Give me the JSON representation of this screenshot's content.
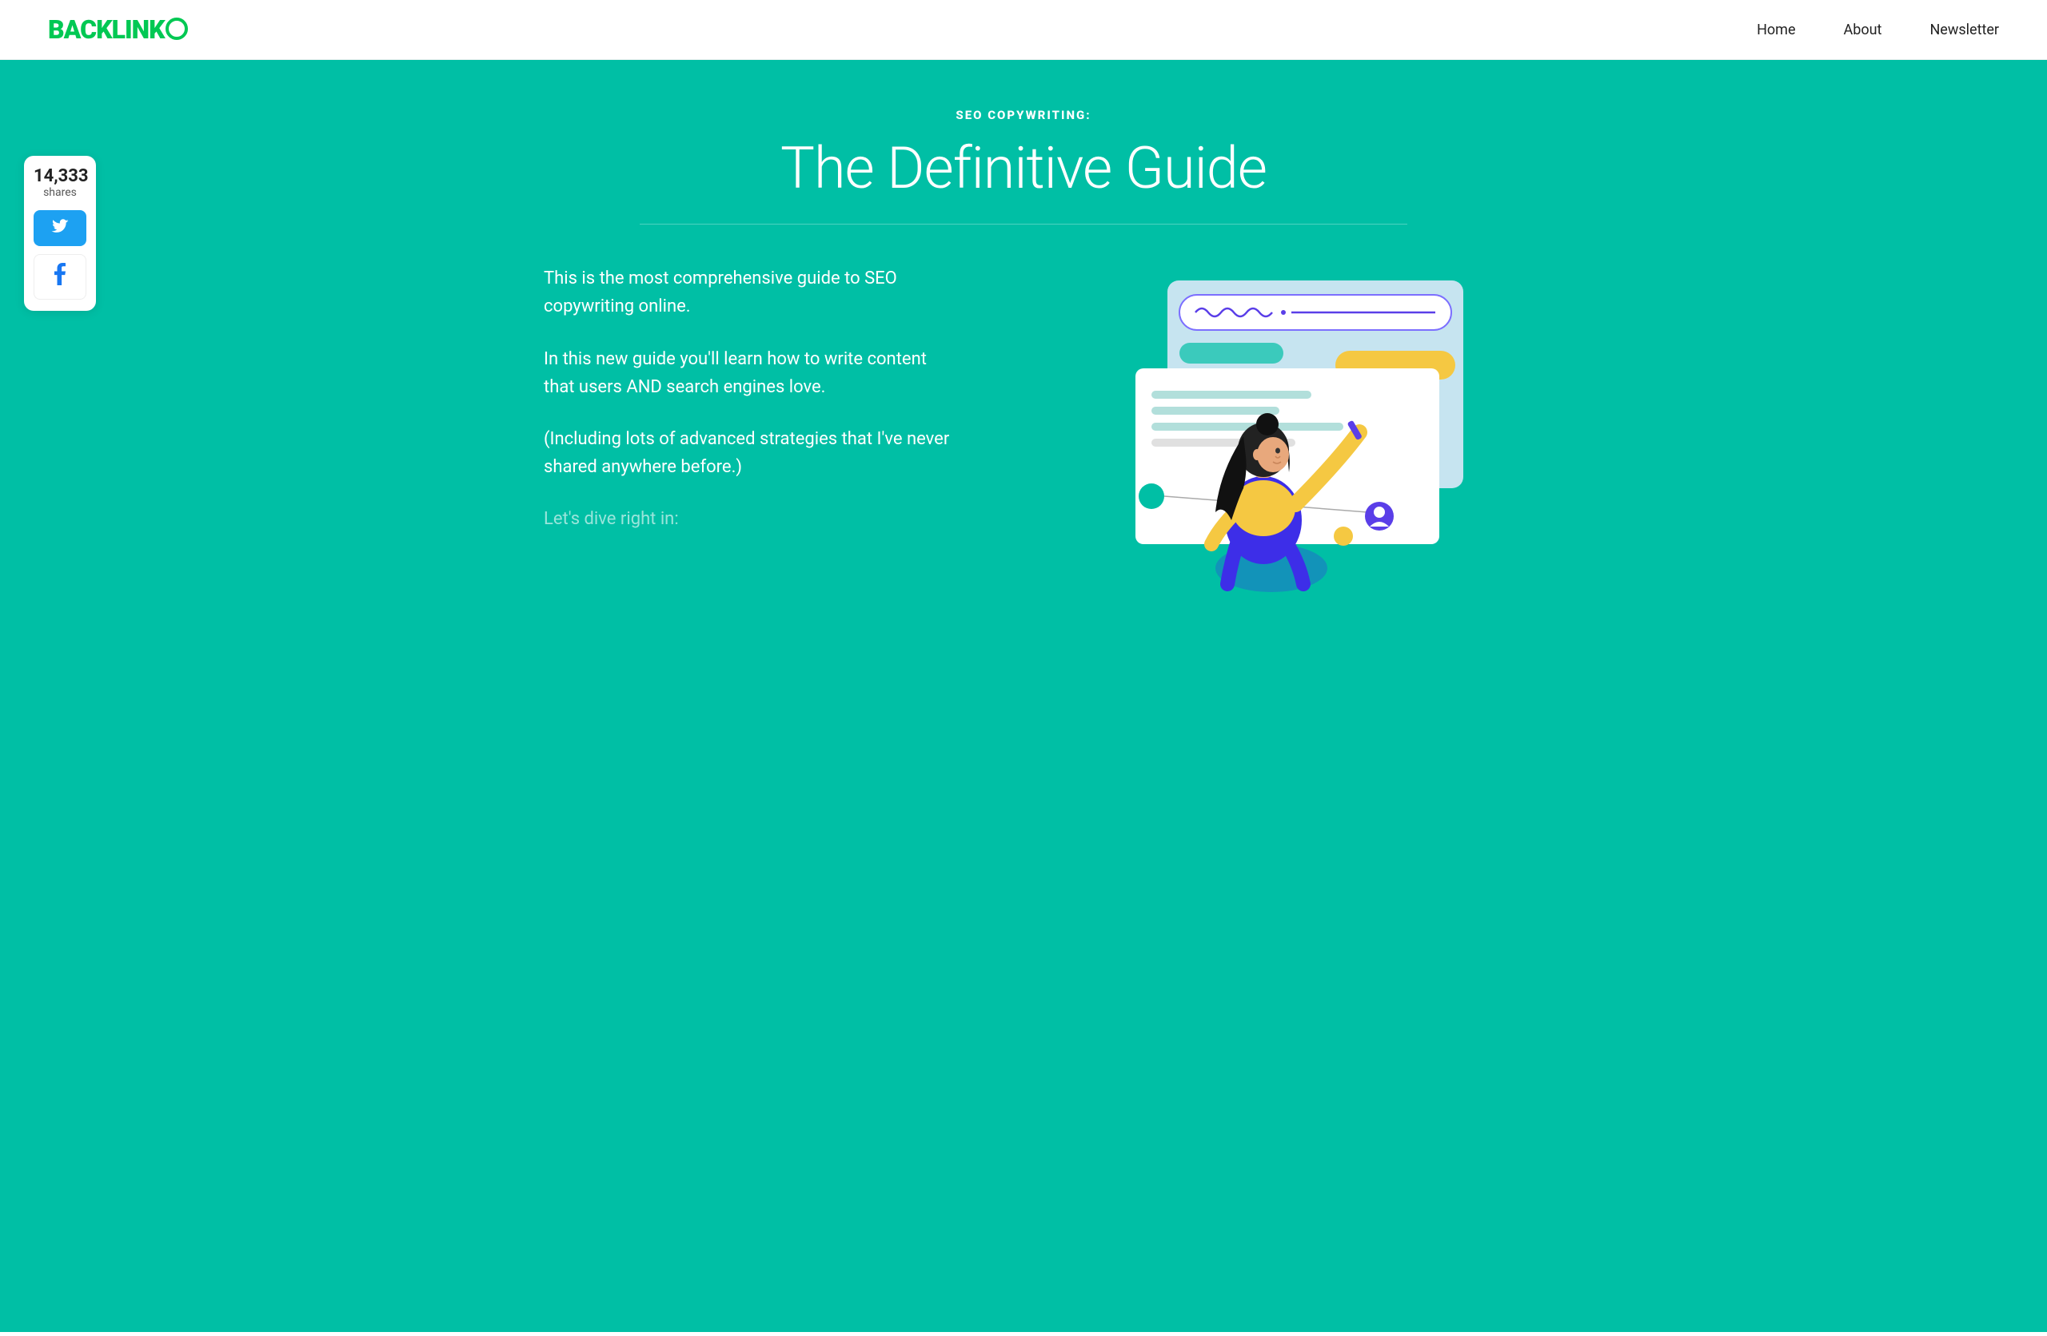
{
  "header": {
    "logo_text": "BACKLINK",
    "nav": [
      {
        "label": "Home",
        "id": "home"
      },
      {
        "label": "About",
        "id": "about"
      },
      {
        "label": "Newsletter",
        "id": "newsletter"
      }
    ]
  },
  "hero": {
    "subtitle": "SEO COPYWRITING:",
    "title": "The Definitive Guide",
    "share": {
      "count": "14,333",
      "label": "shares"
    },
    "paragraphs": [
      "This is the most comprehensive guide to SEO copywriting online.",
      "In this new guide you'll learn how to write content that users AND search engines love.",
      "(Including lots of advanced strategies that I've never shared anywhere before.)"
    ],
    "cta": "Let's dive right in:"
  }
}
